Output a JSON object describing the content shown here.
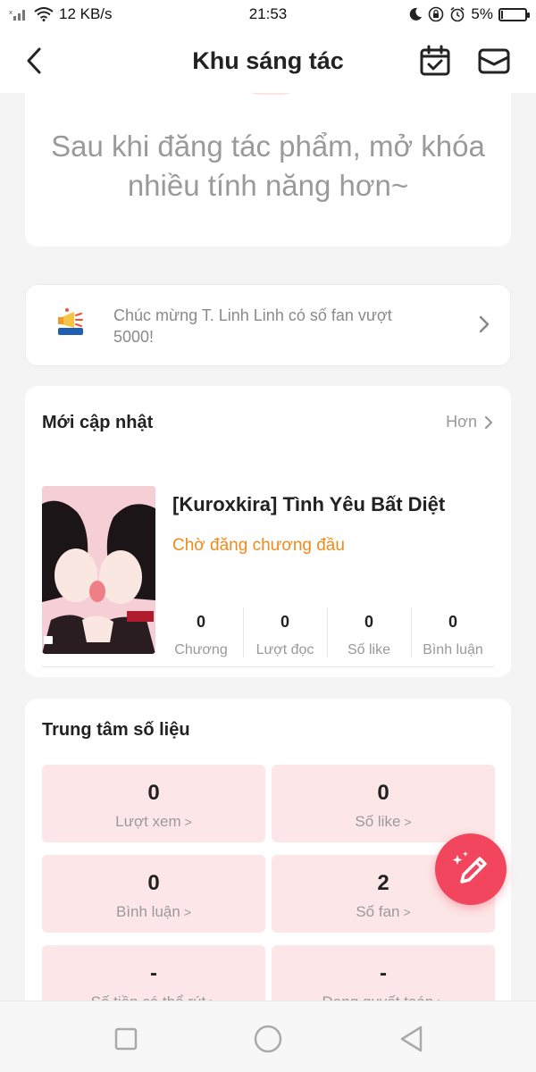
{
  "status_bar": {
    "speed": "12 KB/s",
    "time": "21:53",
    "battery": "5%"
  },
  "header": {
    "title": "Khu sáng tác"
  },
  "promo": {
    "text": "Sau khi đăng tác phẩm, mở khóa nhiều tính năng hơn~"
  },
  "notice": {
    "text": "Chúc mừng T. Linh Linh có số fan vượt 5000!"
  },
  "updates": {
    "title": "Mới cập nhật",
    "more": "Hơn",
    "book": {
      "title": "[Kuroxkira] Tình Yêu Bất Diệt",
      "status": "Chờ đăng chương đầu",
      "stats": [
        {
          "value": "0",
          "label": "Chương"
        },
        {
          "value": "0",
          "label": "Lượt đọc"
        },
        {
          "value": "0",
          "label": "Số like"
        },
        {
          "value": "0",
          "label": "Bình luận"
        }
      ]
    }
  },
  "data_center": {
    "title": "Trung tâm số liệu",
    "tiles": [
      {
        "value": "0",
        "label": "Lượt xem"
      },
      {
        "value": "0",
        "label": "Số like"
      },
      {
        "value": "0",
        "label": "Bình luận"
      },
      {
        "value": "2",
        "label": "Số fan"
      },
      {
        "value": "-",
        "label": "Số tiền có thể rút"
      },
      {
        "value": "-",
        "label": "Đang quyết toán"
      }
    ]
  },
  "colors": {
    "accent": "#f2465f",
    "status_orange": "#f08a1c",
    "tile_bg": "#fde6e7"
  }
}
